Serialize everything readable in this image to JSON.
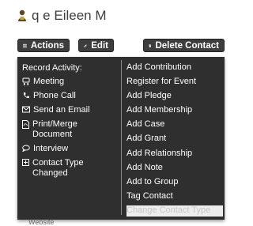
{
  "contact": {
    "name": "q e Eileen M"
  },
  "toolbar": {
    "actions_label": "Actions",
    "edit_label": "Edit",
    "delete_label": "Delete Contact"
  },
  "menu": {
    "record_activity_heading": "Record Activity:",
    "activities": [
      {
        "label": "Meeting",
        "icon": "meeting-icon"
      },
      {
        "label": "Phone Call",
        "icon": "phone-icon"
      },
      {
        "label": "Send an Email",
        "icon": "envelope-icon"
      },
      {
        "label": "Print/Merge Document",
        "icon": "document-icon"
      },
      {
        "label": "Interview",
        "icon": "speech-bubble-icon"
      },
      {
        "label": "Contact Type Changed",
        "icon": "plus-box-icon"
      }
    ],
    "actions": [
      {
        "label": "Add Contribution"
      },
      {
        "label": "Register for Event"
      },
      {
        "label": "Add Pledge"
      },
      {
        "label": "Add Membership"
      },
      {
        "label": "Add Case"
      },
      {
        "label": "Add Grant"
      },
      {
        "label": "Add Relationship"
      },
      {
        "label": "Add Note"
      },
      {
        "label": "Add to Group"
      },
      {
        "label": "Tag Contact"
      },
      {
        "label": "Change Contact Type",
        "disabled": true
      }
    ]
  },
  "below_menu_text": "Website",
  "colors": {
    "menu_background": "#2f2f2f",
    "button_background": "#3d3d3d",
    "disabled_item_background": "#ededed"
  }
}
